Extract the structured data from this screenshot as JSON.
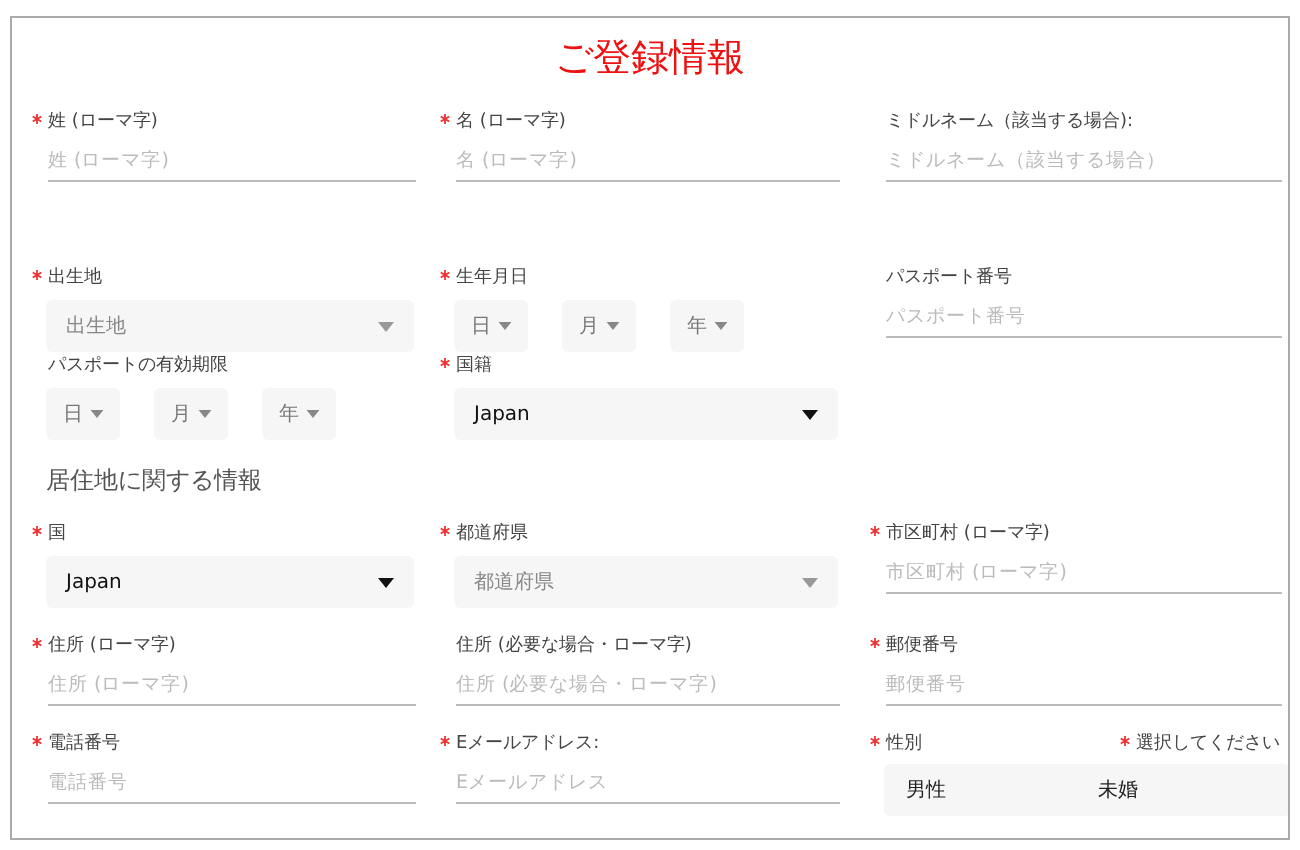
{
  "title": "ご登録情報",
  "rows": [
    {
      "fields": [
        {
          "kind": "text",
          "required": true,
          "label": "姓 (ローマ字)",
          "placeholder": "姓 (ローマ字)"
        },
        {
          "kind": "text",
          "required": true,
          "label": "名 (ローマ字)",
          "placeholder": "名 (ローマ字)"
        },
        {
          "kind": "text",
          "required": false,
          "label": "ミドルネーム（該当する場合):",
          "placeholder": "ミドルネーム（該当する場合）"
        }
      ]
    },
    {
      "fields": [
        {
          "kind": "select",
          "required": true,
          "label": "出生地",
          "placeholder": "出生地"
        },
        {
          "kind": "date",
          "required": true,
          "label": "生年月日",
          "parts": [
            "日",
            "月",
            "年"
          ]
        },
        {
          "kind": "text",
          "required": false,
          "label": "パスポート番号",
          "placeholder": "パスポート番号"
        }
      ]
    },
    {
      "fields": [
        {
          "kind": "date",
          "required": false,
          "label": "パスポートの有効期限",
          "parts": [
            "日",
            "月",
            "年"
          ]
        },
        {
          "kind": "select",
          "required": true,
          "label": "国籍",
          "value": "Japan"
        }
      ]
    },
    {
      "heading": "居住地に関する情報"
    },
    {
      "fields": [
        {
          "kind": "select",
          "required": true,
          "label": "国",
          "value": "Japan"
        },
        {
          "kind": "select",
          "required": true,
          "label": "都道府県",
          "placeholder": "都道府県"
        },
        {
          "kind": "text",
          "required": true,
          "label": "市区町村 (ローマ字)",
          "placeholder": "市区町村 (ローマ字)"
        }
      ]
    },
    {
      "fields": [
        {
          "kind": "text",
          "required": true,
          "label": "住所 (ローマ字)",
          "placeholder": "住所 (ローマ字)"
        },
        {
          "kind": "text",
          "required": false,
          "label": "住所 (必要な場合・ローマ字)",
          "placeholder": "住所 (必要な場合・ローマ字)"
        },
        {
          "kind": "text",
          "required": true,
          "label": "郵便番号",
          "placeholder": "郵便番号"
        }
      ]
    },
    {
      "fields": [
        {
          "kind": "text",
          "required": true,
          "label": "電話番号",
          "placeholder": "電話番号"
        },
        {
          "kind": "text",
          "required": true,
          "label": "Eメールアドレス:",
          "placeholder": "Eメールアドレス"
        },
        {
          "kind": "pair",
          "items": [
            {
              "required": true,
              "label": "性別",
              "value": "男性"
            },
            {
              "required": true,
              "label": "選択してください",
              "value": "未婚"
            }
          ]
        }
      ]
    }
  ]
}
